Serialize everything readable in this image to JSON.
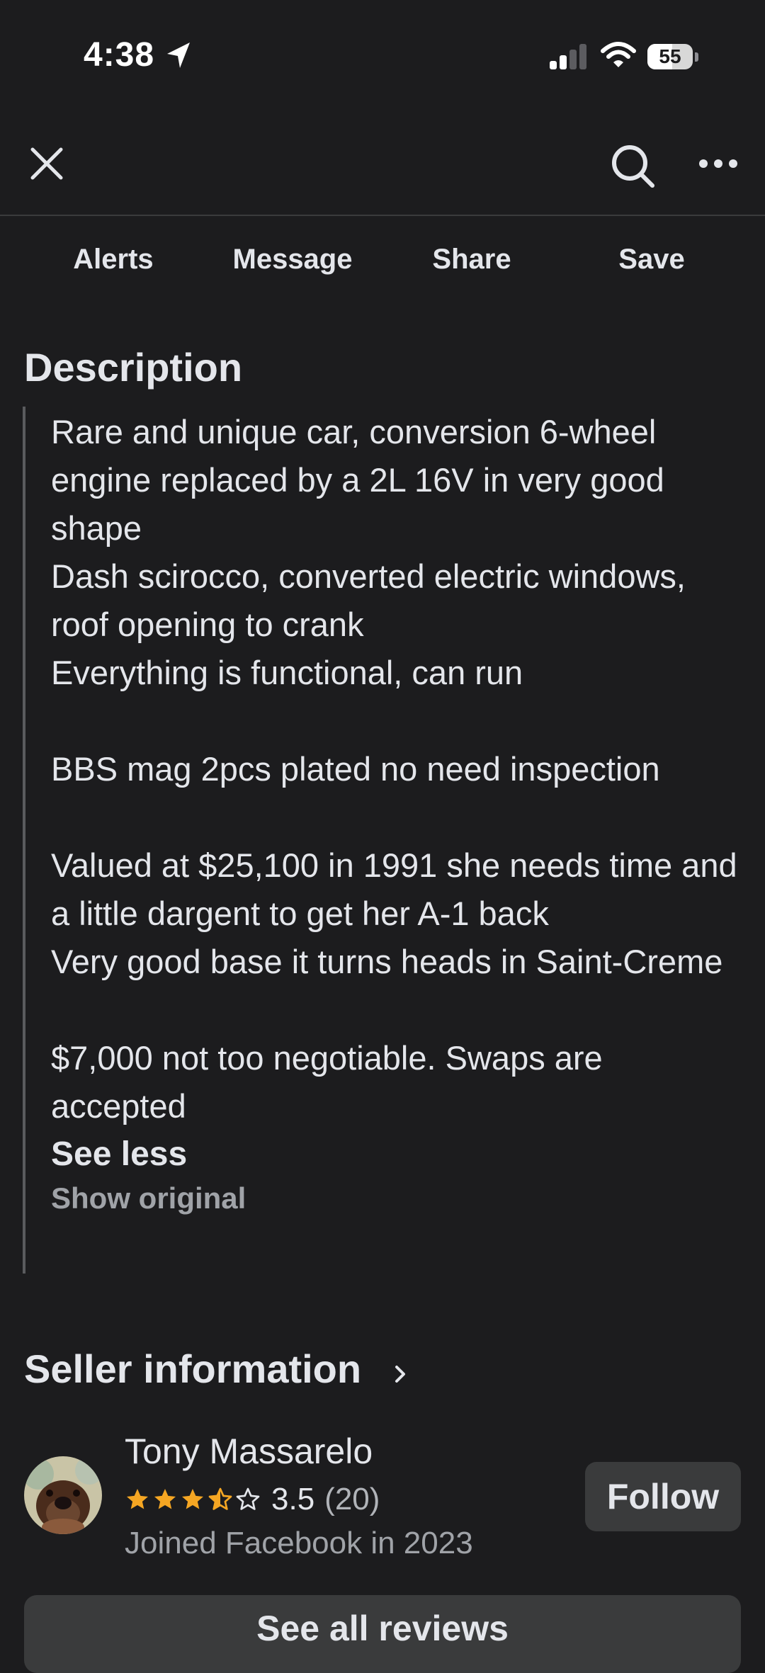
{
  "status_bar": {
    "time": "4:38",
    "battery_level": "55",
    "battery_fraction": 0.55,
    "icons": [
      "location-arrow-icon",
      "cellular-signal-icon",
      "wifi-icon",
      "battery-icon"
    ]
  },
  "top_nav": {
    "icons": [
      "close-icon",
      "search-icon",
      "more-icon"
    ]
  },
  "actions": [
    {
      "label": "Alerts"
    },
    {
      "label": "Message"
    },
    {
      "label": "Share"
    },
    {
      "label": "Save"
    }
  ],
  "description": {
    "title": "Description",
    "body": "Rare and unique car, conversion 6-wheel engine replaced by a 2L 16V in very good shape\nDash scirocco, converted electric windows, roof opening to crank\nEverything is functional, can run\n\nBBS mag 2pcs plated no need inspection\n\nValued at $25,100 in 1991 she needs time and a little dargent to get her A-1 back\nVery good base it turns heads in Saint-Creme\n\n$7,000 not too negotiable. Swaps are accepted",
    "see_less": "See less",
    "show_original": "Show original"
  },
  "seller": {
    "title": "Seller information",
    "name": "Tony Massarelo",
    "rating": 3.5,
    "rating_text": "3.5",
    "review_count": "(20)",
    "joined": "Joined Facebook in 2023",
    "follow_label": "Follow",
    "see_all_reviews": "See all reviews"
  },
  "colors": {
    "background": "#1c1c1e",
    "text": "#e4e6eb",
    "secondary_text": "#a0a3a8",
    "button_bg": "#3a3b3c",
    "star": "#f5a623"
  }
}
